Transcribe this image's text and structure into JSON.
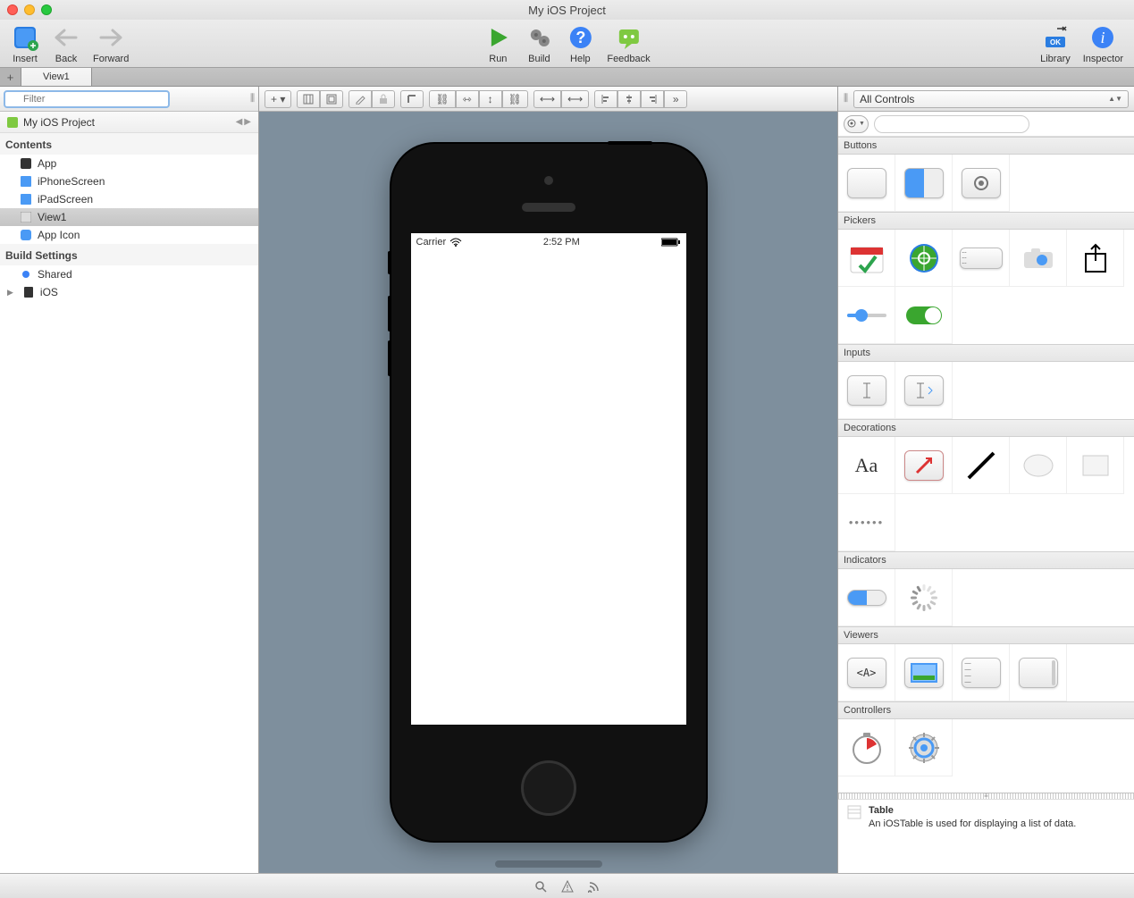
{
  "window": {
    "title": "My iOS Project"
  },
  "toolbar": {
    "insert": "Insert",
    "back": "Back",
    "forward": "Forward",
    "run": "Run",
    "build": "Build",
    "help": "Help",
    "feedback": "Feedback",
    "library": "Library",
    "inspector": "Inspector"
  },
  "tabs": {
    "active": "View1"
  },
  "navigator": {
    "filter_placeholder": "Filter",
    "project": "My iOS Project",
    "sections": {
      "contents": {
        "label": "Contents",
        "items": [
          "App",
          "iPhoneScreen",
          "iPadScreen",
          "View1",
          "App Icon"
        ]
      },
      "build": {
        "label": "Build Settings",
        "items": [
          "Shared",
          "iOS"
        ]
      }
    },
    "selected": "View1"
  },
  "device_preview": {
    "status_carrier": "Carrier",
    "status_time": "2:52 PM"
  },
  "inspector": {
    "filter_label": "All Controls",
    "sections": [
      {
        "name": "Buttons",
        "items": [
          "button",
          "segmented-button",
          "settings-button"
        ]
      },
      {
        "name": "Pickers",
        "items": [
          "date-picker",
          "location-picker",
          "scroll-picker",
          "camera-picker",
          "share-picker",
          "slider",
          "switch"
        ]
      },
      {
        "name": "Inputs",
        "items": [
          "text-field",
          "search-field"
        ]
      },
      {
        "name": "Decorations",
        "items": [
          "label",
          "image-well",
          "line",
          "oval",
          "rectangle",
          "separator"
        ]
      },
      {
        "name": "Indicators",
        "items": [
          "progress-bar",
          "spinner"
        ]
      },
      {
        "name": "Viewers",
        "items": [
          "html-viewer",
          "image-viewer",
          "table",
          "scroll-view"
        ]
      },
      {
        "name": "Controllers",
        "items": [
          "timer",
          "thread"
        ]
      }
    ],
    "description": {
      "title": "Table",
      "body": "An iOSTable is used for displaying a list of data."
    }
  }
}
